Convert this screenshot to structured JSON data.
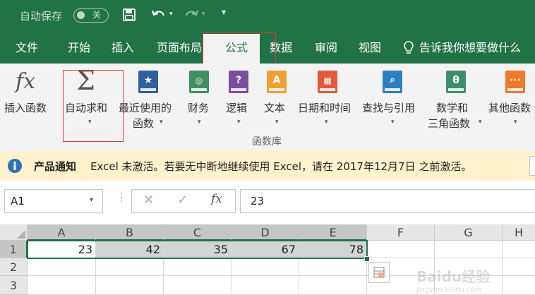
{
  "titlebar": {
    "autosave_label": "自动保存",
    "autosave_state": "关"
  },
  "tabs": [
    {
      "label": "文件"
    },
    {
      "label": "开始"
    },
    {
      "label": "插入"
    },
    {
      "label": "页面布局"
    },
    {
      "label": "公式"
    },
    {
      "label": "数据"
    },
    {
      "label": "审阅"
    },
    {
      "label": "视图"
    }
  ],
  "tell_me": "告诉我你想要做什么",
  "ribbon": {
    "insert_function": "插入函数",
    "autosum": "自动求和",
    "recently_used_1": "最近使用的",
    "recently_used_2": "函数",
    "financial": "财务",
    "logical": "逻辑",
    "text": "文本",
    "datetime": "日期和时间",
    "lookup": "查找与引用",
    "math_1": "数学和",
    "math_2": "三角函数",
    "more_1": "其他函数",
    "group_label": "函数库",
    "icons": {
      "fx": "fx",
      "sigma": "Σ",
      "logical_glyph": "?",
      "text_glyph": "A",
      "math_glyph": "θ"
    },
    "colors": {
      "recent": "#2f5f9e",
      "financial": "#3f8f5f",
      "logical": "#7b4f9f",
      "text": "#f0a030",
      "datetime": "#e05a3c",
      "lookup": "#2e7fc0",
      "math": "#3f8f6f",
      "more": "#f07a2a"
    }
  },
  "notice": {
    "title": "产品通知",
    "message": "Excel 未激活。若要无中断地继续使用 Excel，请在 2017年12月7日 之前激活。"
  },
  "formula_bar": {
    "name_box": "A1",
    "value": "23",
    "fx": "fx"
  },
  "columns": [
    "A",
    "B",
    "C",
    "D",
    "E",
    "F",
    "G",
    "H"
  ],
  "rows": [
    {
      "label": "1",
      "cells": [
        "23",
        "42",
        "35",
        "67",
        "78",
        "",
        "",
        ""
      ]
    },
    {
      "label": "2",
      "cells": [
        "",
        "",
        "",
        "",
        "",
        "",
        "",
        ""
      ]
    },
    {
      "label": "3",
      "cells": [
        "",
        "",
        "",
        "",
        "",
        "",
        "",
        ""
      ]
    }
  ],
  "watermark": "Baidu经验 jingyan.baidu.com"
}
